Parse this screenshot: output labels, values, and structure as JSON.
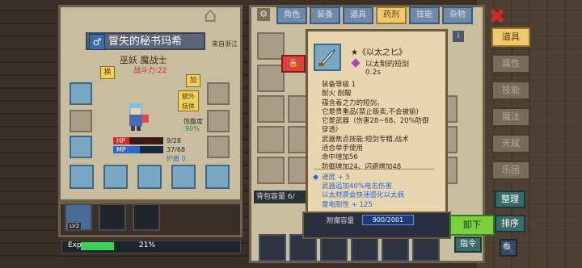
{
  "character": {
    "name": "冒失的秘书玛希",
    "origin": "来自浙江",
    "class": "巫妖 魔战士",
    "power": "战斗力:22",
    "swap_label": "换",
    "add_label": "加",
    "extra_label_1": "额外",
    "extra_label_2": "技体",
    "satiety_label": "饱腹度",
    "satiety_value": "90%",
    "hp_label": "HP",
    "hp_value": "9/28",
    "hp_fraction": 0.32,
    "mp_label": "MP",
    "mp_value": "37/68",
    "mp_fraction": 0.54,
    "shield_label": "护盾 0",
    "level": "LV2",
    "exp_label": "Exp",
    "exp_value": "21%",
    "exp_fraction": 0.21
  },
  "inventory": {
    "tabs": [
      "角色",
      "装备",
      "道具",
      "药剂",
      "技能",
      "杂物"
    ],
    "active_tab": 3,
    "capacity_label": "背包容量 6/"
  },
  "tooltip": {
    "title": "★《以太之匕》",
    "subtitle": "以太制的短剑",
    "time": "0.2s",
    "description": [
      "装备等级 1",
      "耐火  耐酸",
      "蕴含着之力的短剑。",
      "它是贵重品(禁止贩卖,不会被偷)",
      "它是武器（伤害28~68、20%防御",
      "穿透）",
      "武器焦点技能:短剑专精,战术",
      "适合单手使用",
      "命中增加56",
      "防御增加24、闪避增加48"
    ],
    "stats": [
      "速度 + 5",
      "武器追加40%电击伤害",
      "以太材质会快速感化以太病",
      "雷电耐性 + 125"
    ],
    "capacity_label": "附魔容量",
    "capacity_value": "900/2001"
  },
  "right_menu": {
    "items": [
      "道具",
      "属性",
      "技能",
      "魔法",
      "天赋",
      "乐团"
    ],
    "active": 0
  },
  "buttons": {
    "sort": "整理",
    "order": "排序",
    "unload": "卸下",
    "command": "指令",
    "close": "✖",
    "search": "🔍"
  }
}
